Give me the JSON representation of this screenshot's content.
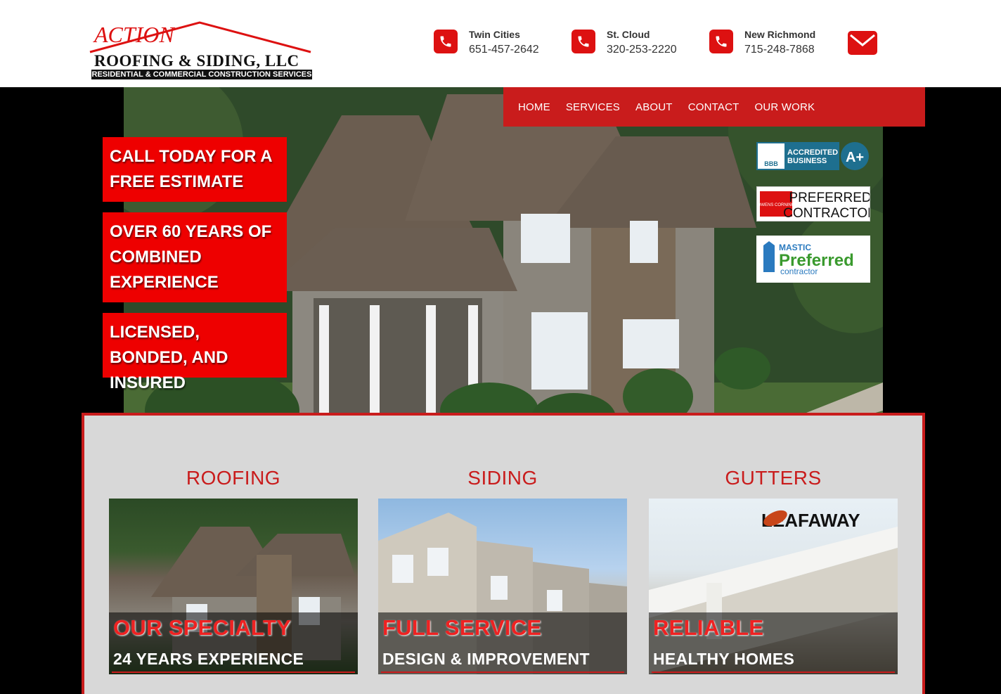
{
  "brand": {
    "action_text": "ACTION",
    "company": "ROOFING & SIDING, LLC",
    "tagline": "RESIDENTIAL & COMMERCIAL CONSTRUCTION SERVICES",
    "accent_color": "#c91c1c"
  },
  "contacts": [
    {
      "city": "Twin Cities",
      "phone": "651-457-2642",
      "icon": "phone-icon"
    },
    {
      "city": "St. Cloud",
      "phone": "320-253-2220",
      "icon": "phone-icon"
    },
    {
      "city": "New Richmond",
      "phone": "715-248-7868",
      "icon": "phone-icon"
    }
  ],
  "email_icon": "mail-icon",
  "nav": {
    "items": [
      "HOME",
      "SERVICES",
      "ABOUT",
      "CONTACT",
      "OUR WORK"
    ]
  },
  "hero": {
    "promos": [
      "CALL TODAY FOR A FREE ESTIMATE",
      "OVER 60 YEARS OF COMBINED EXPERIENCE",
      "LICENSED, BONDED, AND INSURED"
    ],
    "badges": {
      "bbb_line1": "ACCREDITED",
      "bbb_line2": "BUSINESS",
      "bbb_logo": "BBB",
      "bbb_rating": "A+",
      "owens_logo": "OWENS CORNING",
      "owens_line1": "PREFERRED",
      "owens_line2": "CONTRACTOR",
      "mastic_brand": "MASTIC",
      "mastic_main": "Preferred",
      "mastic_sub": "contractor"
    }
  },
  "services": [
    {
      "title": "ROOFING",
      "headline": "OUR SPECIALTY",
      "subline": "24 YEARS EXPERIENCE"
    },
    {
      "title": "SIDING",
      "headline": "FULL SERVICE",
      "subline": "DESIGN & IMPROVEMENT"
    },
    {
      "title": "GUTTERS",
      "headline": "RELIABLE",
      "subline": "HEALTHY HOMES",
      "logo": "LEAFAWAY"
    }
  ]
}
